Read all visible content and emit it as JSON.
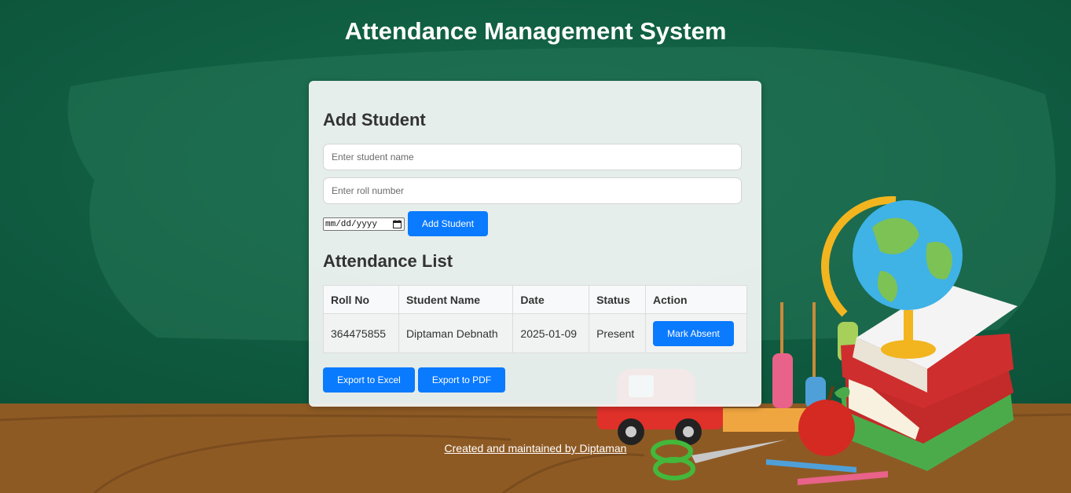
{
  "page": {
    "title": "Attendance Management System",
    "footer_link": "Created and maintained by Diptaman"
  },
  "add_student": {
    "heading": "Add Student",
    "name_placeholder": "Enter student name",
    "roll_placeholder": "Enter roll number",
    "date_placeholder": "mm/dd/yyyy",
    "submit_label": "Add Student"
  },
  "attendance": {
    "heading": "Attendance List",
    "columns": [
      "Roll No",
      "Student Name",
      "Date",
      "Status",
      "Action"
    ],
    "rows": [
      {
        "roll": "364475855",
        "name": "Diptaman Debnath",
        "date": "2025-01-09",
        "status": "Present",
        "action_label": "Mark Absent"
      }
    ]
  },
  "export": {
    "excel_label": "Export to Excel",
    "pdf_label": "Export to PDF"
  },
  "colors": {
    "board_green": "#0e5a41",
    "button_blue": "#0a7aff",
    "desk_brown": "#8e5a24"
  },
  "icons": {
    "date_picker": "calendar-icon"
  }
}
